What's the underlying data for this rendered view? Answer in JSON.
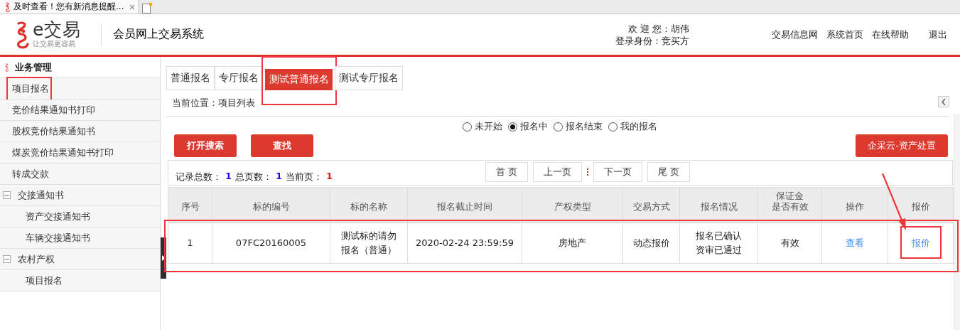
{
  "browser_tab": {
    "title": "及时查看！您有新消息提醒..."
  },
  "header": {
    "logo_text": "e交易",
    "logo_slogan": "让交易更容易",
    "system_title": "会员网上交易系统",
    "welcome_label": "欢 迎 您：",
    "user_name": "胡伟",
    "role_label": "登录身份：",
    "role": "竞买方",
    "links": [
      "交易信息网",
      "系统首页",
      "在线帮助",
      "退出"
    ]
  },
  "sidebar": {
    "title": "业务管理",
    "items": [
      {
        "label": "项目报名",
        "highlighted": true
      },
      {
        "label": "竞价结果通知书打印"
      },
      {
        "label": "股权竞价结果通知书"
      },
      {
        "label": "煤炭竞价结果通知书打印"
      },
      {
        "label": "转成交款"
      },
      {
        "label": "交接通知书",
        "expanded": true,
        "children": [
          {
            "label": "资产交接通知书"
          },
          {
            "label": "车辆交接通知书"
          }
        ]
      },
      {
        "label": "农村产权",
        "expanded": true,
        "children": [
          {
            "label": "项目报名"
          }
        ]
      }
    ]
  },
  "tabs": [
    {
      "label": "普通报名",
      "selected": false
    },
    {
      "label": "专厅报名",
      "selected": false
    },
    {
      "label": "测试普通报名",
      "selected": true,
      "highlighted": true
    },
    {
      "label": "测试专厅报名",
      "selected": false
    }
  ],
  "breadcrumb": {
    "label": "当前位置：",
    "value": "项目列表"
  },
  "status_filter": [
    {
      "label": "未开始",
      "selected": false
    },
    {
      "label": "报名中",
      "selected": true
    },
    {
      "label": "报名结束",
      "selected": false
    },
    {
      "label": "我的报名",
      "selected": false
    }
  ],
  "buttons": [
    "打开搜索",
    "查找"
  ],
  "action_button": "企采云-资产处置",
  "pager": [
    "首 页",
    "上一页",
    "下一页",
    "尾 页"
  ],
  "summary": [
    {
      "label": "记录总数：",
      "value": "1",
      "color": "#1414d8"
    },
    {
      "label": "总页数：",
      "value": "1",
      "color": "#1414d8"
    },
    {
      "label": "当前页：",
      "value": "1",
      "color": "#e8141c"
    }
  ],
  "table": {
    "columns": [
      {
        "lines": [
          "序号"
        ]
      },
      {
        "lines": [
          "标的编号"
        ]
      },
      {
        "lines": [
          "标的名称"
        ]
      },
      {
        "lines": [
          "报名截止时间"
        ]
      },
      {
        "lines": [
          "产权类型"
        ]
      },
      {
        "lines": [
          "交易方式"
        ]
      },
      {
        "lines": [
          "报名情况"
        ]
      },
      {
        "lines": [
          "保证金",
          "是否有效"
        ]
      },
      {
        "lines": [
          "操作"
        ]
      },
      {
        "lines": [
          "报价"
        ]
      }
    ],
    "rows": [
      {
        "highlighted": true,
        "cells": [
          {
            "kind": "text",
            "text": "1"
          },
          {
            "kind": "text",
            "text": "07FC20160005"
          },
          {
            "kind": "text",
            "text": "测试标的请勿报名（普通）"
          },
          {
            "kind": "text",
            "text": "2020-02-24 23:59:59"
          },
          {
            "kind": "text",
            "text": "房地产"
          },
          {
            "kind": "text",
            "text": "动态报价"
          },
          {
            "kind": "text",
            "text": "报名已确认资审已通过"
          },
          {
            "kind": "text",
            "text": "有效"
          },
          {
            "kind": "link",
            "text": "查看"
          },
          {
            "kind": "link",
            "text": "报价",
            "highlighted": true
          }
        ]
      }
    ]
  }
}
